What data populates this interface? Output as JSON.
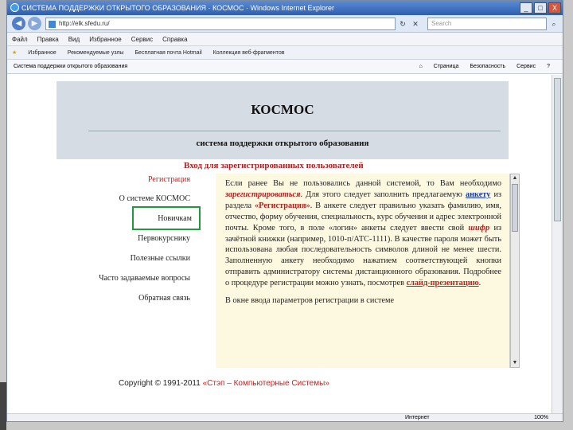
{
  "window": {
    "title": "СИСТЕМА ПОДДЕРЖКИ ОТКРЫТОГО ОБРАЗОВАНИЯ · КОСМОС · Windows Internet Explorer"
  },
  "window_controls": {
    "minimize": "_",
    "maximize": "□",
    "close": "X"
  },
  "address": {
    "value": "http://elk.sfedu.ru/",
    "search_placeholder": "Search"
  },
  "menu": [
    "Файл",
    "Правка",
    "Вид",
    "Избранное",
    "Сервис",
    "Справка"
  ],
  "favorites": [
    "Избранное",
    "Рекомендуемые узлы",
    "Бесплатная почта Hotmail",
    "Коллекция веб-фрагментов"
  ],
  "command": {
    "left": "Система поддержки открытого образования",
    "right": [
      "Страница",
      "Безопасность",
      "Сервис"
    ]
  },
  "site": {
    "brand": "КОСМОС",
    "subtitle": "система поддержки открытого образования",
    "login_heading": "Вход для зарегистрированных пользователей"
  },
  "nav": [
    {
      "label": "Регистрация"
    },
    {
      "label": "О системе КОСМОС"
    },
    {
      "label": "Новичкам"
    },
    {
      "label": "Первокурснику"
    },
    {
      "label": "Полезные ссылки"
    },
    {
      "label": "Часто задаваемые вопросы"
    },
    {
      "label": "Обратная связь"
    }
  ],
  "content": {
    "p1a": "Если ранее Вы не пользовались данной системой, то Вам необходимо",
    "p1_red": "зарегистрироваться",
    "p1b": ". Для этого следует заполнить предлагаемую",
    "p1_link": "анкету",
    "p1c": "из раздела",
    "p1_bold": "«Регистрация»",
    "p1d": ". В анкете следует правильно указать фамилию, имя, отчество, форму обучения, специальность, курс обучения и адрес электронной почты. Кроме того, в поле «логин» анкеты следует ввести свой",
    "p1_red2": "шифр",
    "p1e": "из зачётной книжки (например, 1010-п/АТС-1111). В качестве пароля может быть использована любая последовательность символов длиной не менее шести. Заполненную анкету необходимо нажатием соответствующей кнопки отправить администратору системы дистанционного образования. Подробнее о процедуре регистрации можно узнать, посмотрев",
    "p1_link2": "слайд-презентацию",
    "p1f": ".",
    "p2": "В окне ввода параметров регистрации в системе"
  },
  "footer": {
    "copyright": "Copyright © 1991-2011",
    "company": "«Стэп – Компьютерные Системы»"
  },
  "status": {
    "zone": "Интернет",
    "zoom": "100%"
  }
}
